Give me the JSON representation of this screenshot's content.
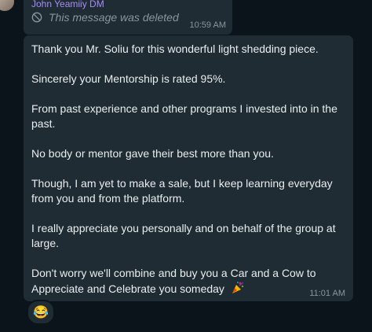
{
  "deleted_message": {
    "sender": "John Yeamiiy DM",
    "text": "This message was deleted",
    "time": "10:59 AM"
  },
  "message": {
    "paragraphs": [
      [
        "Thank you Mr. Soliu for this wonderful light shedding piece."
      ],
      [
        "Sincerely your Mentorship is rated 95%."
      ],
      [
        "From past experience and other programs I invested into in the",
        "past."
      ],
      [
        "No body or mentor gave their best more than you."
      ],
      [
        "Though, I am yet to make a sale, but I keep learning everyday",
        "from you and from the platform."
      ],
      [
        "I really appreciate you personally and on behalf of the group at",
        "large."
      ],
      [
        "Don't worry we'll combine and buy you a Car and a Cow to",
        "Appreciate and Celebrate you someday"
      ]
    ],
    "time": "11:01 AM",
    "trailing_icon": "party-popper-icon"
  },
  "reaction": {
    "emoji": "😂"
  },
  "colors": {
    "background": "#0b141a",
    "bubble": "#202c33",
    "text": "#e9edef",
    "meta": "#8696a0",
    "sender": "#a78bfa"
  }
}
